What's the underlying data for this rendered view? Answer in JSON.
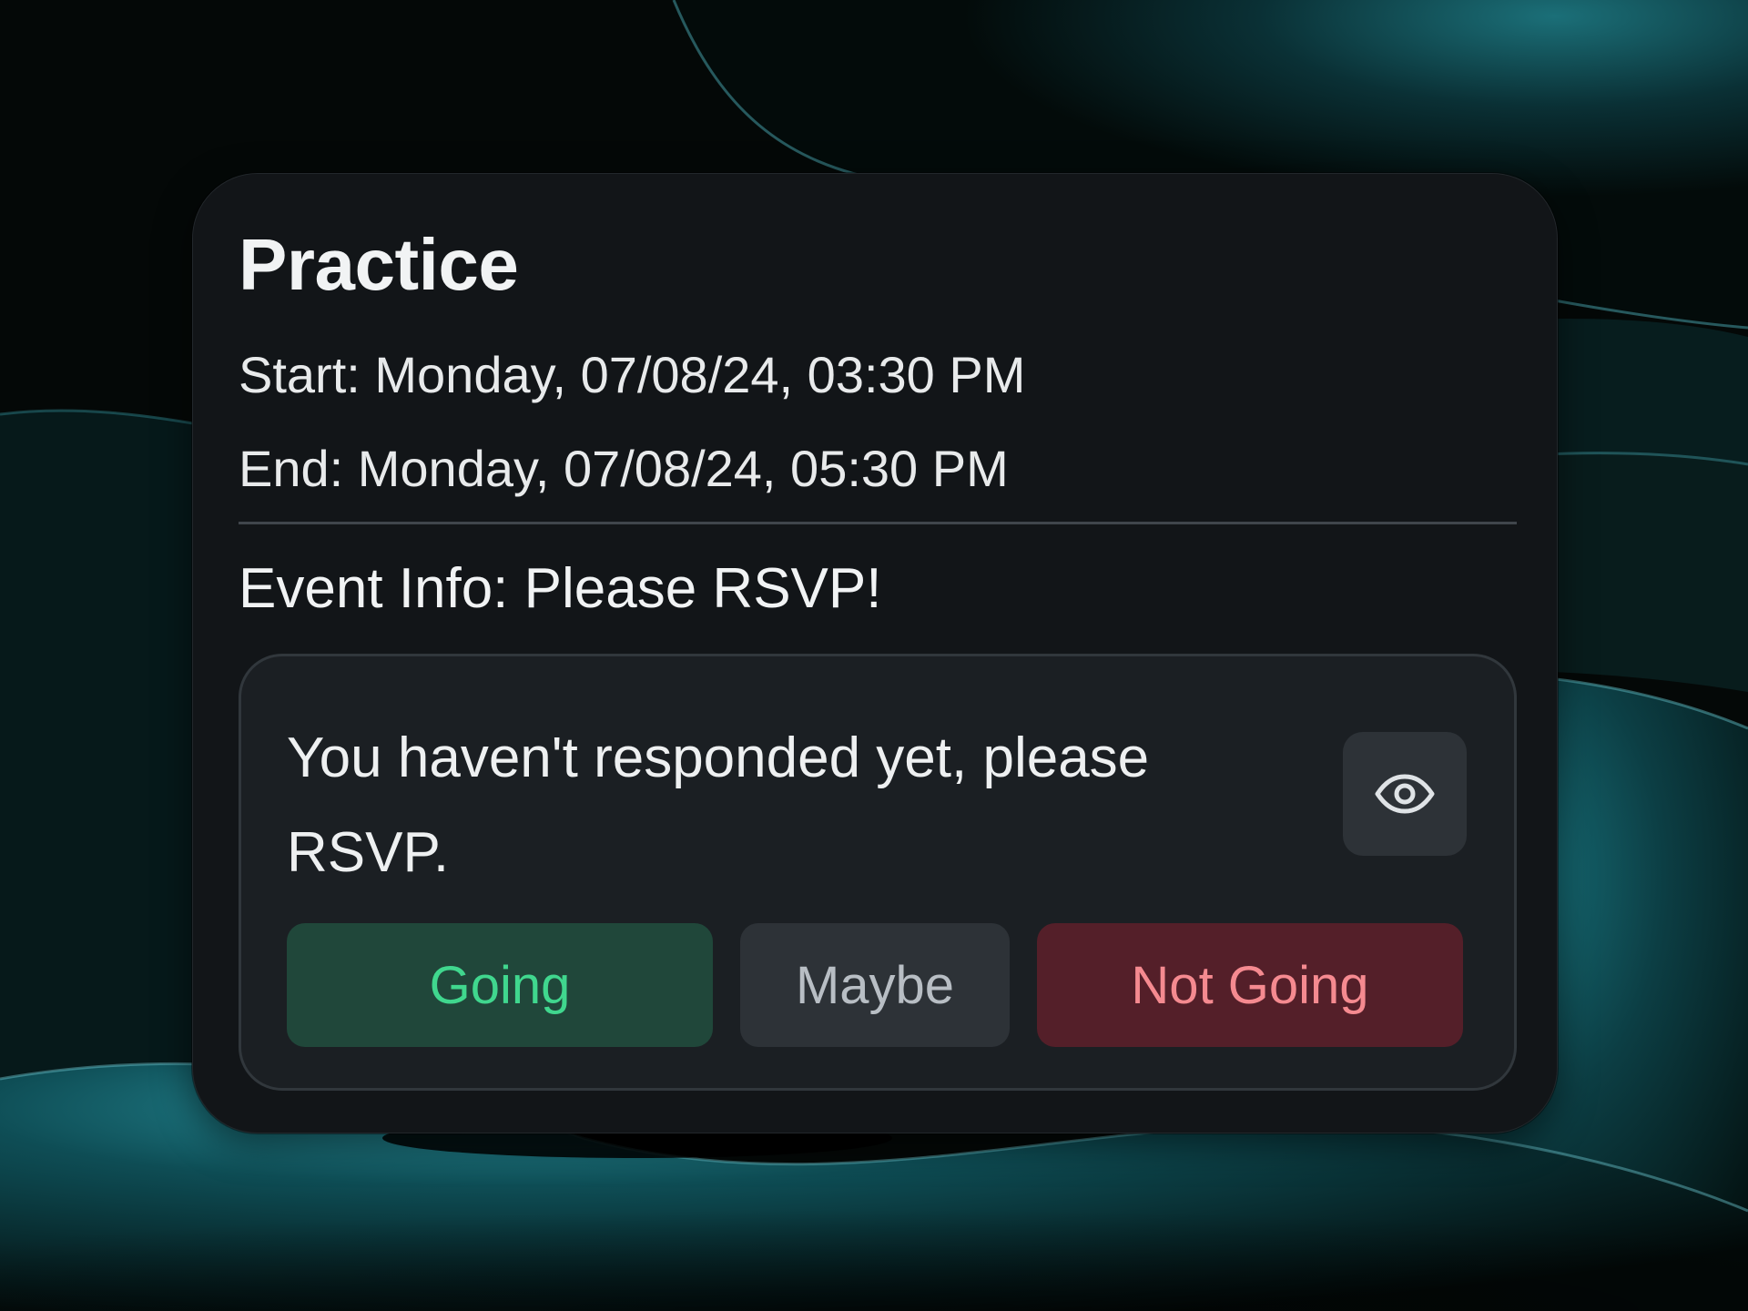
{
  "event": {
    "title": "Practice",
    "start": "Start: Monday, 07/08/24, 03:30 PM",
    "end": "End: Monday, 07/08/24, 05:30 PM",
    "info": "Event Info: Please RSVP!"
  },
  "rsvp": {
    "message": "You haven't responded yet, please RSVP.",
    "view_icon": "eye-icon",
    "options": {
      "going": "Going",
      "maybe": "Maybe",
      "not_going": "Not Going"
    }
  },
  "colors": {
    "card_background": "#121518",
    "rsvp_box_background": "#1b1f23",
    "going_background": "#20473a",
    "going_text": "#40d78e",
    "maybe_background": "#2d3237",
    "maybe_text": "#b8bec4",
    "not_going_background": "#541f29",
    "not_going_text": "#f58a90",
    "page_background": "#040807",
    "wave_accent": "#14747e"
  }
}
